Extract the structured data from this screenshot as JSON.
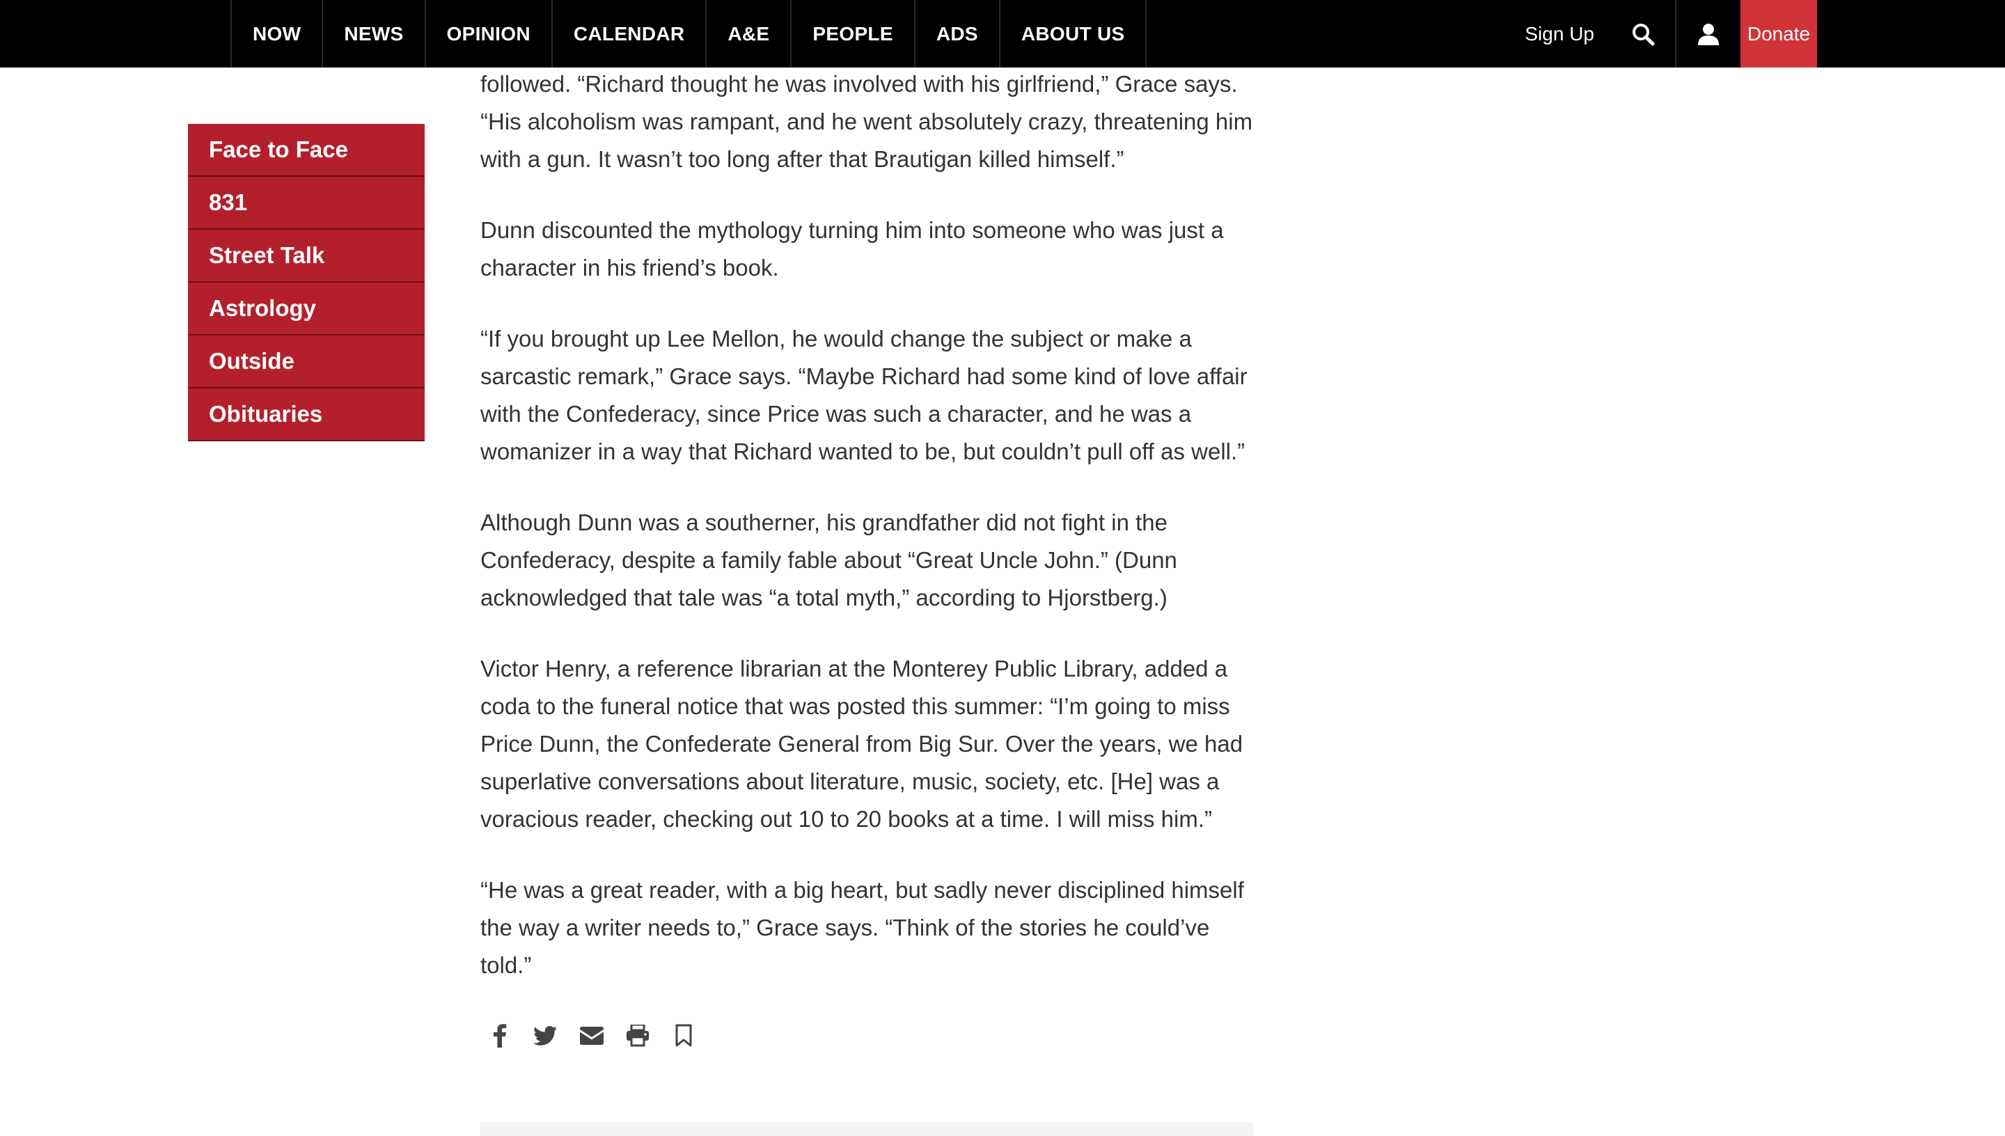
{
  "nav": {
    "items": [
      "NOW",
      "NEWS",
      "OPINION",
      "CALENDAR",
      "A&E",
      "PEOPLE",
      "ADS",
      "ABOUT US"
    ],
    "signup": "Sign Up",
    "donate": "Donate"
  },
  "sidebar": {
    "items": [
      "Face to Face",
      "831",
      "Street Talk",
      "Astrology",
      "Outside",
      "Obituaries"
    ]
  },
  "article": {
    "paragraphs": [
      "followed. “Richard thought he was involved with his girlfriend,” Grace says. “His alcoholism was rampant, and he went absolutely crazy, threatening him with a gun. It wasn’t too long after that Brautigan killed himself.”",
      "Dunn discounted the mythology turning him into someone who was just a character in his friend’s book.",
      "“If you brought up Lee Mellon, he would change the subject or make a sarcastic remark,” Grace says. “Maybe Richard had some kind of love affair with the Confederacy, since Price was such a character, and he was a womanizer in a way that Richard wanted to be, but couldn’t pull off as well.”",
      "Although Dunn was a southerner, his grandfather did not fight in the Confederacy, despite a family fable about “Great Uncle John.” (Dunn acknowledged that tale was “a total myth,” according to Hjorstberg.)",
      "Victor Henry, a reference librarian at the Monterey Public Library, added a coda to the funeral notice that was posted this summer: “I’m going to miss Price Dunn, the Confederate General from Big Sur. Over the years, we had superlative conversations about literature, music, society, etc. [He] was a voracious reader, checking out 10 to 20 books at a time. I will miss him.”",
      "“He was a great reader, with a big heart, but sadly never disciplined himself the way a writer needs to,” Grace says. “Think of the stories he could’ve told.”"
    ]
  },
  "share": {
    "icons": [
      "facebook-icon",
      "twitter-icon",
      "email-icon",
      "print-icon",
      "bookmark-icon"
    ]
  },
  "colors": {
    "nav_bg": "#000000",
    "donate_bg": "#d13438",
    "sidebar_bg": "#b3202c",
    "body_text": "#333333"
  }
}
